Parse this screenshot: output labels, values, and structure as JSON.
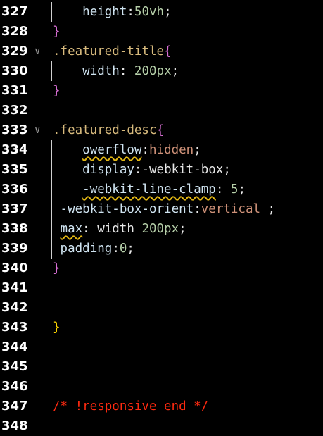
{
  "lines": [
    {
      "n": "327",
      "guide": true,
      "tokens": [
        {
          "t": "    ",
          "c": "punct"
        },
        {
          "t": "height",
          "c": "prop"
        },
        {
          "t": ":",
          "c": "punct"
        },
        {
          "t": "50vh",
          "c": "num"
        },
        {
          "t": ";",
          "c": "punct"
        }
      ]
    },
    {
      "n": "328",
      "tokens": [
        {
          "t": "}",
          "c": "brace"
        }
      ]
    },
    {
      "n": "329",
      "fold": true,
      "tokens": [
        {
          "t": ".featured-title",
          "c": "sel"
        },
        {
          "t": "{",
          "c": "brace"
        }
      ]
    },
    {
      "n": "330",
      "guide": true,
      "tokens": [
        {
          "t": "    ",
          "c": "punct"
        },
        {
          "t": "width",
          "c": "prop"
        },
        {
          "t": ": ",
          "c": "punct"
        },
        {
          "t": "200px",
          "c": "num"
        },
        {
          "t": ";",
          "c": "punct"
        }
      ]
    },
    {
      "n": "331",
      "tokens": [
        {
          "t": "}",
          "c": "brace"
        }
      ]
    },
    {
      "n": "332",
      "tokens": []
    },
    {
      "n": "333",
      "fold": true,
      "tokens": [
        {
          "t": ".featured-desc",
          "c": "sel"
        },
        {
          "t": "{",
          "c": "brace"
        }
      ]
    },
    {
      "n": "334",
      "guide": true,
      "tokens": [
        {
          "t": "    ",
          "c": "punct"
        },
        {
          "t": "owerflow",
          "c": "prop",
          "squiggle": true
        },
        {
          "t": ":",
          "c": "punct"
        },
        {
          "t": "hidden",
          "c": "val"
        },
        {
          "t": ";",
          "c": "punct"
        }
      ]
    },
    {
      "n": "335",
      "guide": true,
      "tokens": [
        {
          "t": "    ",
          "c": "punct"
        },
        {
          "t": "display",
          "c": "prop"
        },
        {
          "t": ":-webkit-box;",
          "c": "punct"
        }
      ]
    },
    {
      "n": "336",
      "guide": true,
      "tokens": [
        {
          "t": "    ",
          "c": "punct"
        },
        {
          "t": "-webkit-line-clamp",
          "c": "prop",
          "squiggle": true
        },
        {
          "t": ": ",
          "c": "punct"
        },
        {
          "t": "5",
          "c": "num"
        },
        {
          "t": ";",
          "c": "punct"
        }
      ]
    },
    {
      "n": "337",
      "guide": true,
      "tokens": [
        {
          "t": " ",
          "c": "punct"
        },
        {
          "t": "-webkit-box-orient",
          "c": "prop"
        },
        {
          "t": ":",
          "c": "punct"
        },
        {
          "t": "vertical",
          "c": "val"
        },
        {
          "t": " ;",
          "c": "punct"
        }
      ]
    },
    {
      "n": "338",
      "guide": true,
      "tokens": [
        {
          "t": " ",
          "c": "punct"
        },
        {
          "t": "max",
          "c": "prop",
          "squiggle": true
        },
        {
          "t": ": width ",
          "c": "punct"
        },
        {
          "t": "200px",
          "c": "num"
        },
        {
          "t": ";",
          "c": "punct"
        }
      ]
    },
    {
      "n": "339",
      "guide": true,
      "tokens": [
        {
          "t": " ",
          "c": "punct"
        },
        {
          "t": "padding",
          "c": "prop"
        },
        {
          "t": ":",
          "c": "punct"
        },
        {
          "t": "0",
          "c": "num"
        },
        {
          "t": ";",
          "c": "punct"
        }
      ]
    },
    {
      "n": "340",
      "tokens": [
        {
          "t": "}",
          "c": "brace"
        }
      ]
    },
    {
      "n": "341",
      "tokens": []
    },
    {
      "n": "342",
      "tokens": []
    },
    {
      "n": "343",
      "tokens": [
        {
          "t": "}",
          "c": "gold"
        }
      ]
    },
    {
      "n": "344",
      "tokens": []
    },
    {
      "n": "345",
      "tokens": []
    },
    {
      "n": "346",
      "tokens": []
    },
    {
      "n": "347",
      "tokens": [
        {
          "t": "/* !responsive end */",
          "c": "cmt"
        }
      ]
    },
    {
      "n": "348",
      "tokens": []
    }
  ]
}
